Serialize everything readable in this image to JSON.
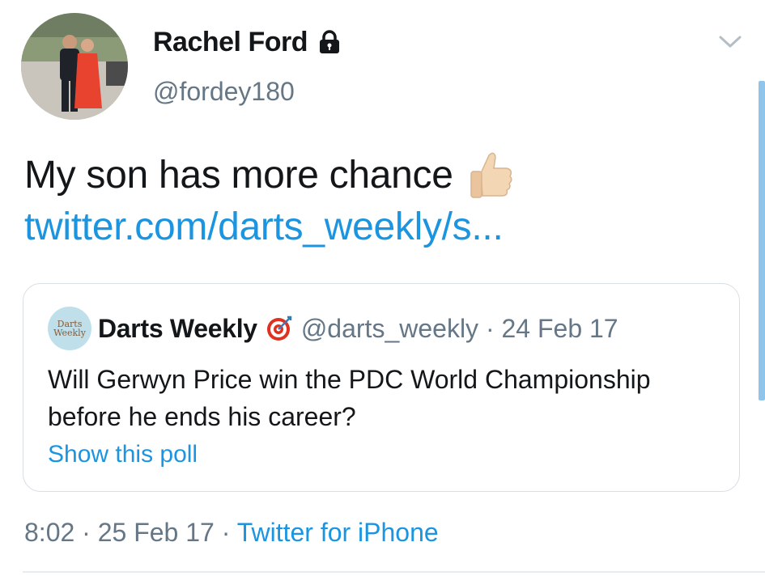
{
  "author": {
    "display_name": "Rachel Ford",
    "handle": "@fordey180",
    "avatar": "profile-photo",
    "protected_icon": "lock-icon"
  },
  "menu_icon": "chevron-down-icon",
  "tweet": {
    "text": "My son has more chance",
    "emoji": "thumbs-up-icon",
    "link": "twitter.com/darts_weekly/s..."
  },
  "quoted_tweet": {
    "avatar_text_line1": "Darts",
    "avatar_text_line2": "Weekly",
    "display_name": "Darts Weekly",
    "verified_icon": "dartboard-icon",
    "handle": "@darts_weekly",
    "separator": "·",
    "date": "24 Feb 17",
    "text": "Will Gerwyn Price win the PDC World Championship before he ends his career?",
    "poll_link": "Show this poll"
  },
  "footer": {
    "time": "8:02",
    "separator": "·",
    "date": "25 Feb 17",
    "source": "Twitter for iPhone"
  },
  "colors": {
    "link": "#1b95e0",
    "secondary_text": "#657786",
    "border": "#d8dee2",
    "scrollbar": "#8fc5ea"
  }
}
